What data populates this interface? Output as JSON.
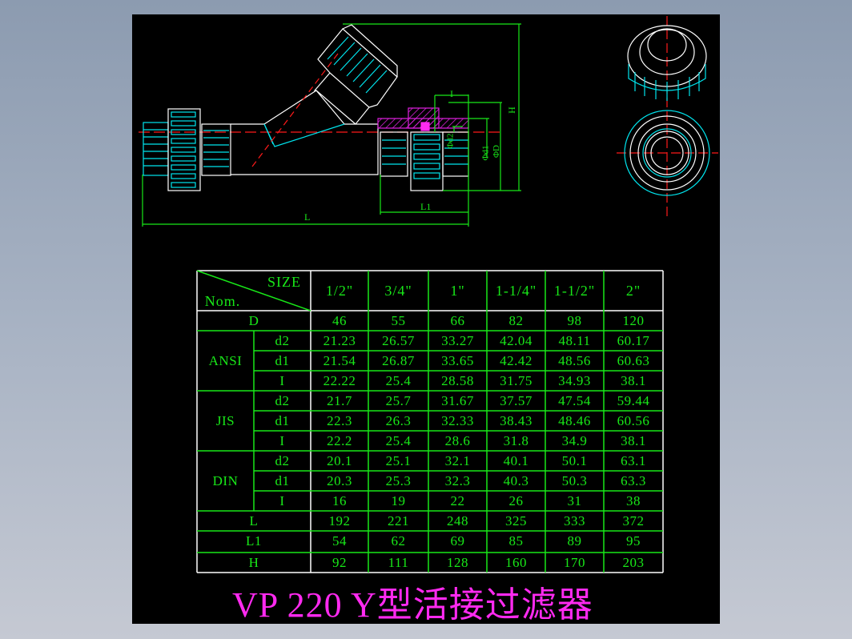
{
  "drawing": {
    "title": "VP 220 Y型活接过滤器",
    "dimension_labels": {
      "L": "L",
      "L1": "L1",
      "H": "H",
      "I": "I",
      "d2": "Φd2",
      "d1": "Φd1",
      "D": "ΦD"
    },
    "colors": {
      "background": "#000000",
      "outline": "#ffffff",
      "thread": "#00e5ee",
      "dimension": "#18e818",
      "centerline": "#ff1a1a",
      "section_hatch": "#e020e0",
      "title": "#ff2af0",
      "grid_white": "#ffffff"
    }
  },
  "table": {
    "corner": {
      "top_right": "SIZE",
      "bottom_left": "Nom."
    },
    "sizes": [
      "1/2\"",
      "3/4\"",
      "1\"",
      "1-1/4\"",
      "1-1/2\"",
      "2\""
    ],
    "rows": [
      {
        "group": "D",
        "sub": "",
        "values": [
          "46",
          "55",
          "66",
          "82",
          "98",
          "120"
        ]
      },
      {
        "group": "ANSI",
        "sub": "d2",
        "values": [
          "21.23",
          "26.57",
          "33.27",
          "42.04",
          "48.11",
          "60.17"
        ]
      },
      {
        "group": "ANSI",
        "sub": "d1",
        "values": [
          "21.54",
          "26.87",
          "33.65",
          "42.42",
          "48.56",
          "60.63"
        ]
      },
      {
        "group": "ANSI",
        "sub": "I",
        "values": [
          "22.22",
          "25.4",
          "28.58",
          "31.75",
          "34.93",
          "38.1"
        ]
      },
      {
        "group": "JIS",
        "sub": "d2",
        "values": [
          "21.7",
          "25.7",
          "31.67",
          "37.57",
          "47.54",
          "59.44"
        ]
      },
      {
        "group": "JIS",
        "sub": "d1",
        "values": [
          "22.3",
          "26.3",
          "32.33",
          "38.43",
          "48.46",
          "60.56"
        ]
      },
      {
        "group": "JIS",
        "sub": "I",
        "values": [
          "22.2",
          "25.4",
          "28.6",
          "31.8",
          "34.9",
          "38.1"
        ]
      },
      {
        "group": "DIN",
        "sub": "d2",
        "values": [
          "20.1",
          "25.1",
          "32.1",
          "40.1",
          "50.1",
          "63.1"
        ]
      },
      {
        "group": "DIN",
        "sub": "d1",
        "values": [
          "20.3",
          "25.3",
          "32.3",
          "40.3",
          "50.3",
          "63.3"
        ]
      },
      {
        "group": "DIN",
        "sub": "I",
        "values": [
          "16",
          "19",
          "22",
          "26",
          "31",
          "38"
        ]
      },
      {
        "group": "L",
        "sub": "",
        "values": [
          "192",
          "221",
          "248",
          "325",
          "333",
          "372"
        ]
      },
      {
        "group": "L1",
        "sub": "",
        "values": [
          "54",
          "62",
          "69",
          "85",
          "89",
          "95"
        ]
      },
      {
        "group": "H",
        "sub": "",
        "values": [
          "92",
          "111",
          "128",
          "160",
          "170",
          "203"
        ]
      }
    ],
    "groups": [
      "ANSI",
      "JIS",
      "DIN"
    ]
  }
}
